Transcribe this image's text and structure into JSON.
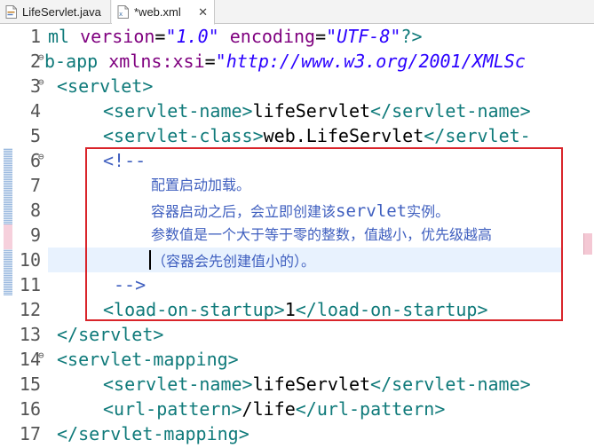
{
  "tabs": [
    {
      "label": "LifeServlet.java",
      "icon": "java-file-icon",
      "active": false
    },
    {
      "label": "*web.xml",
      "icon": "xml-file-icon",
      "active": true,
      "close": "✕"
    }
  ],
  "gutter": {
    "line_numbers": [
      "1",
      "2",
      "3",
      "4",
      "5",
      "6",
      "7",
      "8",
      "9",
      "10",
      "11",
      "12",
      "13",
      "14",
      "15",
      "16",
      "17"
    ],
    "fold_glyph": "⊖"
  },
  "code": {
    "l1": {
      "a": "ml ",
      "b": "version",
      "c": "=",
      "d": "\"1.0\"",
      "e": " ",
      "f": "encoding",
      "g": "=",
      "h": "\"UTF-8\"",
      "i": "?>"
    },
    "l2": {
      "a": "b-app ",
      "b": "xmlns:xsi",
      "c": "=",
      "d": "\"http://www.w3.org/2001/XMLSc"
    },
    "l3": {
      "open": "<",
      "name": "servlet",
      "close": ">"
    },
    "l4": {
      "open": "<",
      "name": "servlet-name",
      "close": ">",
      "text": "lifeServlet",
      "eopen": "</",
      "ename": "servlet-name",
      "eclose": ">"
    },
    "l5": {
      "open": "<",
      "name": "servlet-class",
      "close": ">",
      "text": "web.LifeServlet",
      "eopen": "</",
      "ename": "servlet-"
    },
    "l6": {
      "text": "<!--"
    },
    "l7": {
      "text": "配置启动加载。"
    },
    "l8": {
      "a": "容器启动之后，会立即创建该",
      "b": "servlet",
      "c": "实例。"
    },
    "l9": {
      "text": "参数值是一个大于等于零的整数，值越小，优先级越高"
    },
    "l10": {
      "text": "（容器会先创建值小的）。"
    },
    "l11": {
      "text": "-->"
    },
    "l12": {
      "open": "<",
      "name": "load-on-startup",
      "close": ">",
      "text": "1",
      "eopen": "</",
      "ename": "load-on-startup",
      "eclose": ">"
    },
    "l13": {
      "open": "</",
      "name": "servlet",
      "close": ">"
    },
    "l14": {
      "open": "<",
      "name": "servlet-mapping",
      "close": ">"
    },
    "l15": {
      "open": "<",
      "name": "servlet-name",
      "close": ">",
      "text": "lifeServlet",
      "eopen": "</",
      "ename": "servlet-name",
      "eclose": ">"
    },
    "l16": {
      "open": "<",
      "name": "url-pattern",
      "close": ">",
      "text": "/life",
      "eopen": "</",
      "ename": "url-pattern",
      "eclose": ">"
    },
    "l17": {
      "open": "</",
      "name": "servlet-mapping",
      "close": ">"
    }
  },
  "colors": {
    "highlight_box": "#d9242a",
    "current_line": "#e8f2fe",
    "tag": "#0f7a7a",
    "attr": "#7f007f",
    "string": "#2a00ff",
    "comment": "#3f5fbf"
  }
}
